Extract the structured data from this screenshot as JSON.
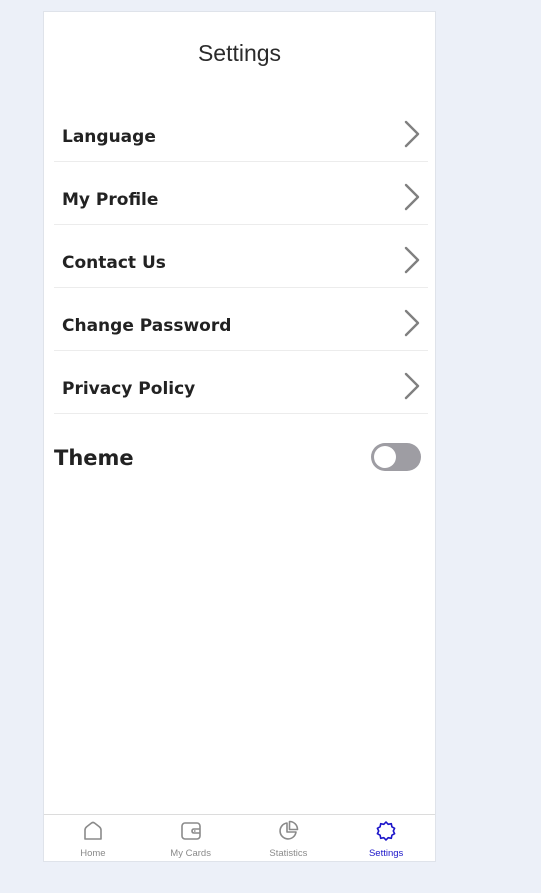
{
  "page": {
    "title": "Settings"
  },
  "menu": {
    "items": [
      {
        "label": "Language",
        "icon": "chevron-right-icon"
      },
      {
        "label": "My Profile",
        "icon": "chevron-right-icon"
      },
      {
        "label": "Contact Us",
        "icon": "chevron-right-icon"
      },
      {
        "label": "Change Password",
        "icon": "chevron-right-icon"
      },
      {
        "label": "Privacy Policy",
        "icon": "chevron-right-icon"
      }
    ]
  },
  "theme": {
    "label": "Theme",
    "enabled": false
  },
  "tabbar": {
    "active_color": "#1b14c9",
    "inactive_color": "#8a8a8a",
    "tabs": [
      {
        "label": "Home",
        "icon": "home-icon",
        "active": false
      },
      {
        "label": "My Cards",
        "icon": "wallet-icon",
        "active": false
      },
      {
        "label": "Statistics",
        "icon": "pie-chart-icon",
        "active": false
      },
      {
        "label": "Settings",
        "icon": "gear-icon",
        "active": true
      }
    ]
  }
}
